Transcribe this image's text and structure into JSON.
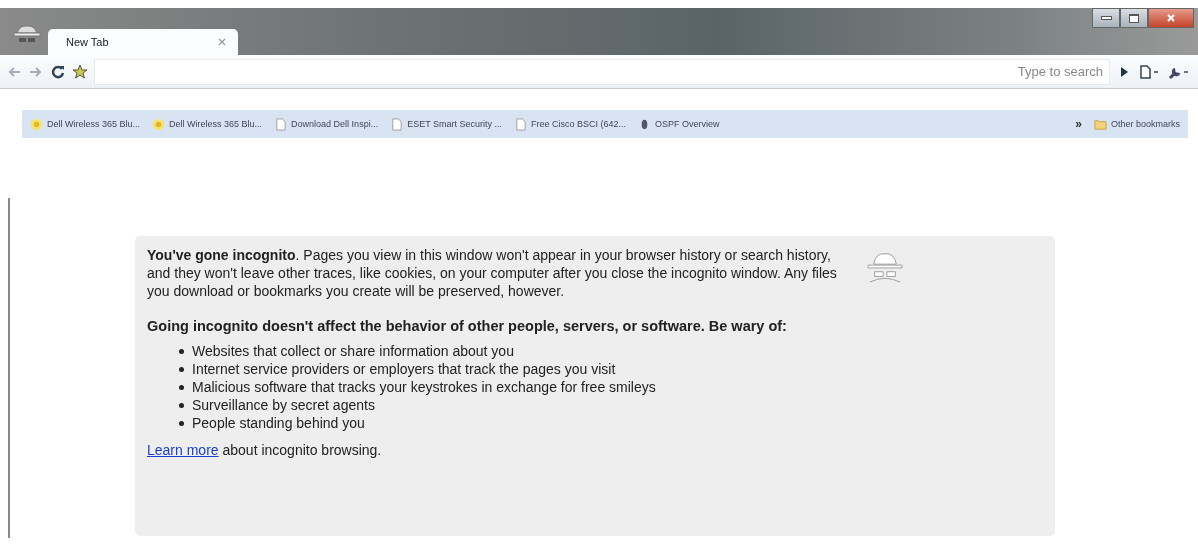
{
  "tabs": [
    {
      "label": "New Tab",
      "selected": true
    }
  ],
  "toolbar": {
    "search_placeholder": "Type to search"
  },
  "bookmarks": [
    {
      "label": "Dell Wireless 365 Blu...",
      "kind": "site"
    },
    {
      "label": "Dell Wireless 365 Blu...",
      "kind": "site"
    },
    {
      "label": "Download Dell Inspi...",
      "kind": "page"
    },
    {
      "label": "ESET Smart Security ...",
      "kind": "page"
    },
    {
      "label": "Free Cisco BSCI (642...",
      "kind": "page"
    },
    {
      "label": "OSPF Overview",
      "kind": "dark"
    }
  ],
  "bookmarks_overflow": "»",
  "other_bookmarks": "Other bookmarks",
  "incognito": {
    "intro": "**You've gone incognito**. Pages you view in this window won't appear in your browser history or search history, and they won't leave other traces, like cookies, on your computer after you close the incognito window. Any files you download or bookmarks you create will be preserved, however.",
    "heading": "Going incognito doesn't affect the behavior of other people, servers, or software. Be wary of:",
    "list": [
      "Websites that collect or share information about you",
      "Internet service providers or employers that track the pages you visit",
      "Malicious software that tracks your keystrokes in exchange for free smileys",
      "Surveillance by secret agents",
      "People standing behind you"
    ],
    "learn_more_link": "Learn more",
    "learn_more_rest": "about incognito browsing."
  }
}
